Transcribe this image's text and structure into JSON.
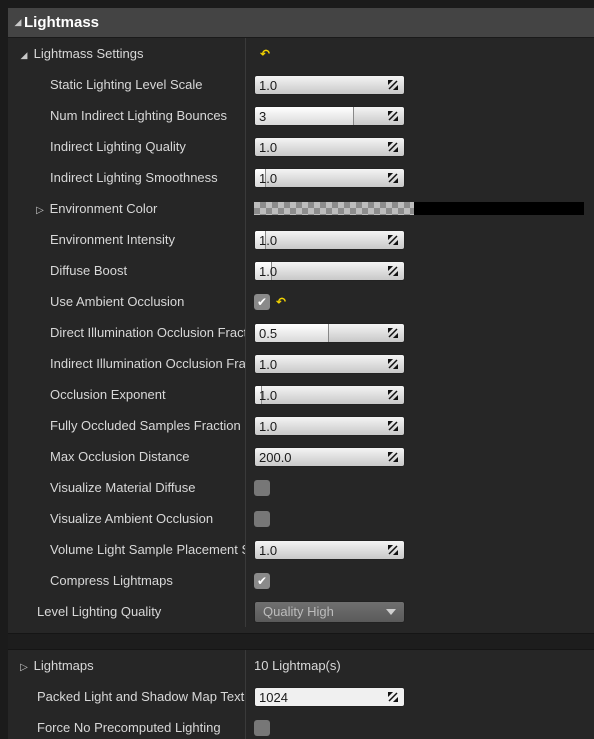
{
  "header": {
    "title": "Lightmass"
  },
  "settings": {
    "label": "Lightmass Settings",
    "rows": [
      {
        "label": "Static Lighting Level Scale",
        "value": "1.0",
        "fill": 0.0
      },
      {
        "label": "Num Indirect Lighting Bounces",
        "value": "3",
        "fill": 0.66
      },
      {
        "label": "Indirect Lighting Quality",
        "value": "1.0",
        "fill": 0.0
      },
      {
        "label": "Indirect Lighting Smoothness",
        "value": "1.0",
        "fill": 0.07
      },
      {
        "label": "Environment Color"
      },
      {
        "label": "Environment Intensity",
        "value": "1.0",
        "fill": 0.07
      },
      {
        "label": "Diffuse Boost",
        "value": "1.0",
        "fill": 0.11
      },
      {
        "label": "Use Ambient Occlusion",
        "checked": true
      },
      {
        "label": "Direct Illumination Occlusion Fraction",
        "value": "0.5",
        "fill": 0.49
      },
      {
        "label": "Indirect Illumination Occlusion Fraction",
        "value": "1.0",
        "fill": 0.0
      },
      {
        "label": "Occlusion Exponent",
        "value": "1.0",
        "fill": 0.04
      },
      {
        "label": "Fully Occluded Samples Fraction",
        "value": "1.0",
        "fill": 0.0
      },
      {
        "label": "Max Occlusion Distance",
        "value": "200.0",
        "fill": 0.0
      },
      {
        "label": "Visualize Material Diffuse",
        "checked": false
      },
      {
        "label": "Visualize Ambient Occlusion",
        "checked": false
      },
      {
        "label": "Volume Light Sample Placement Scale",
        "value": "1.0",
        "fill": 0.0
      },
      {
        "label": "Compress Lightmaps",
        "checked": true
      }
    ]
  },
  "level_quality": {
    "label": "Level Lighting Quality",
    "value": "Quality High"
  },
  "lightmaps": {
    "label": "Lightmaps",
    "value": "10 Lightmap(s)",
    "packed_label": "Packed Light and Shadow Map Texture Size",
    "packed_value": "1024",
    "force_label": "Force No Precomputed Lighting",
    "force_checked": false
  },
  "icons": {
    "reset": "reset-to-default-icon",
    "expand": "expand-arrow-icon",
    "spin": "drag-arrows-icon"
  },
  "colors": {
    "reset_arrow": "#f4d400",
    "env_color": "#000000"
  }
}
